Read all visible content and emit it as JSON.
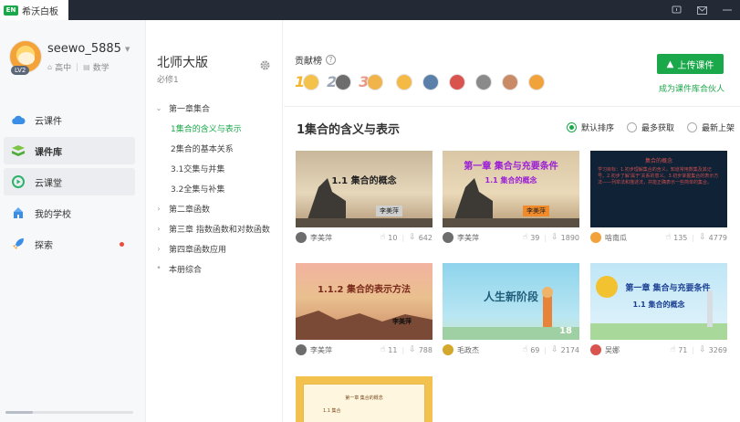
{
  "app": {
    "title": "希沃白板",
    "logo_text": "EN"
  },
  "titlebar": {
    "icons": [
      "feedback-icon",
      "mail-icon"
    ]
  },
  "profile": {
    "username": "seewo_5885",
    "level": "LV2",
    "school_level": "高中",
    "subject": "数学"
  },
  "nav": [
    {
      "label": "云课件",
      "icon": "cloud-icon"
    },
    {
      "label": "课件库",
      "icon": "library-icon"
    },
    {
      "label": "云课堂",
      "icon": "classroom-icon"
    },
    {
      "label": "我的学校",
      "icon": "school-icon"
    },
    {
      "label": "探索",
      "icon": "rocket-icon"
    }
  ],
  "tree": {
    "book_title": "北师大版",
    "book_sub": "必修1",
    "items": [
      "第一章集合",
      "1集合的含义与表示",
      "2集合的基本关系",
      "3.1交集与并集",
      "3.2全集与补集",
      "第二章函数",
      "第三章 指数函数和对数函数",
      "第四章函数应用",
      "本册综合"
    ]
  },
  "main": {
    "contrib_title": "贡献榜",
    "help_mark": "?",
    "ranks": [
      "1",
      "2",
      "3"
    ],
    "upload_label": "上传课件",
    "partner_link": "成为课件库合伙人",
    "section_title": "1集合的含义与表示",
    "sorts": [
      "默认排序",
      "最多获取",
      "最新上架"
    ],
    "cards": [
      {
        "title": "1.1 集合的概念",
        "sub": "",
        "tag": "李美萍",
        "author": "李美萍",
        "likes": "10",
        "downloads": "642"
      },
      {
        "title": "第一章 集合与充要条件",
        "sub": "1.1 集合的概念",
        "tag": "李美萍",
        "author": "李美萍",
        "likes": "39",
        "downloads": "1890"
      },
      {
        "title": "集合的概念",
        "sub": "学习目标：1.初步理解集合的含义，知道常用数集及其记号。2.初步了解'属于'关系的意义。3.初步掌握集合的表示方法——列举法和描述法，并能正确表示一些简单的集合。",
        "tag": "",
        "author": "啥南瓜",
        "likes": "135",
        "downloads": "4779"
      },
      {
        "title": "1.1.2 集合的表示方法",
        "sub": "",
        "tag": "李美萍",
        "author": "李美萍",
        "likes": "11",
        "downloads": "788"
      },
      {
        "title": "人生新阶段",
        "sub": "",
        "tag": "18",
        "author": "毛政杰",
        "likes": "69",
        "downloads": "2174"
      },
      {
        "title": "第一章 集合与充要条件",
        "sub": "1.1 集合的概念",
        "tag": "",
        "author": "吴娜",
        "likes": "71",
        "downloads": "3269"
      },
      {
        "title": "第一章 集合的概念",
        "sub": "1.1 集合",
        "tag": "",
        "author": "",
        "likes": "",
        "downloads": ""
      }
    ]
  }
}
